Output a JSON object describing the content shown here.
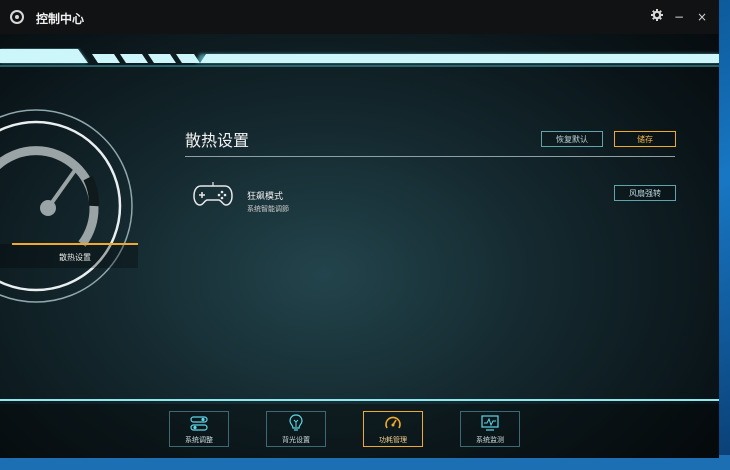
{
  "app": {
    "title": "控制中心"
  },
  "window_controls": {
    "settings_icon": "gear-icon",
    "minimize": "−",
    "close": "×"
  },
  "left_panel": {
    "tab_label": "散热设置",
    "gauge_icon": "speedometer-icon"
  },
  "main": {
    "section_title": "散热设置",
    "restore_default_label": "恢复默认",
    "save_label": "储存",
    "mode": {
      "icon": "gamepad-icon",
      "title": "狂飙模式",
      "subtitle": "系统智能调節",
      "fan_button_label": "风扇强转"
    }
  },
  "bottom_nav": {
    "items": [
      {
        "label": "系统调整",
        "icon": "toggle-switches-icon",
        "active": false
      },
      {
        "label": "背光设置",
        "icon": "light-bulb-icon",
        "active": false
      },
      {
        "label": "功耗管理",
        "icon": "speedometer-icon",
        "active": true
      },
      {
        "label": "系统监测",
        "icon": "monitor-chart-icon",
        "active": false
      }
    ]
  },
  "colors": {
    "accent_orange": "#f0a92b",
    "accent_cyan": "#5fd6e8",
    "frame": "#3c6a72"
  }
}
